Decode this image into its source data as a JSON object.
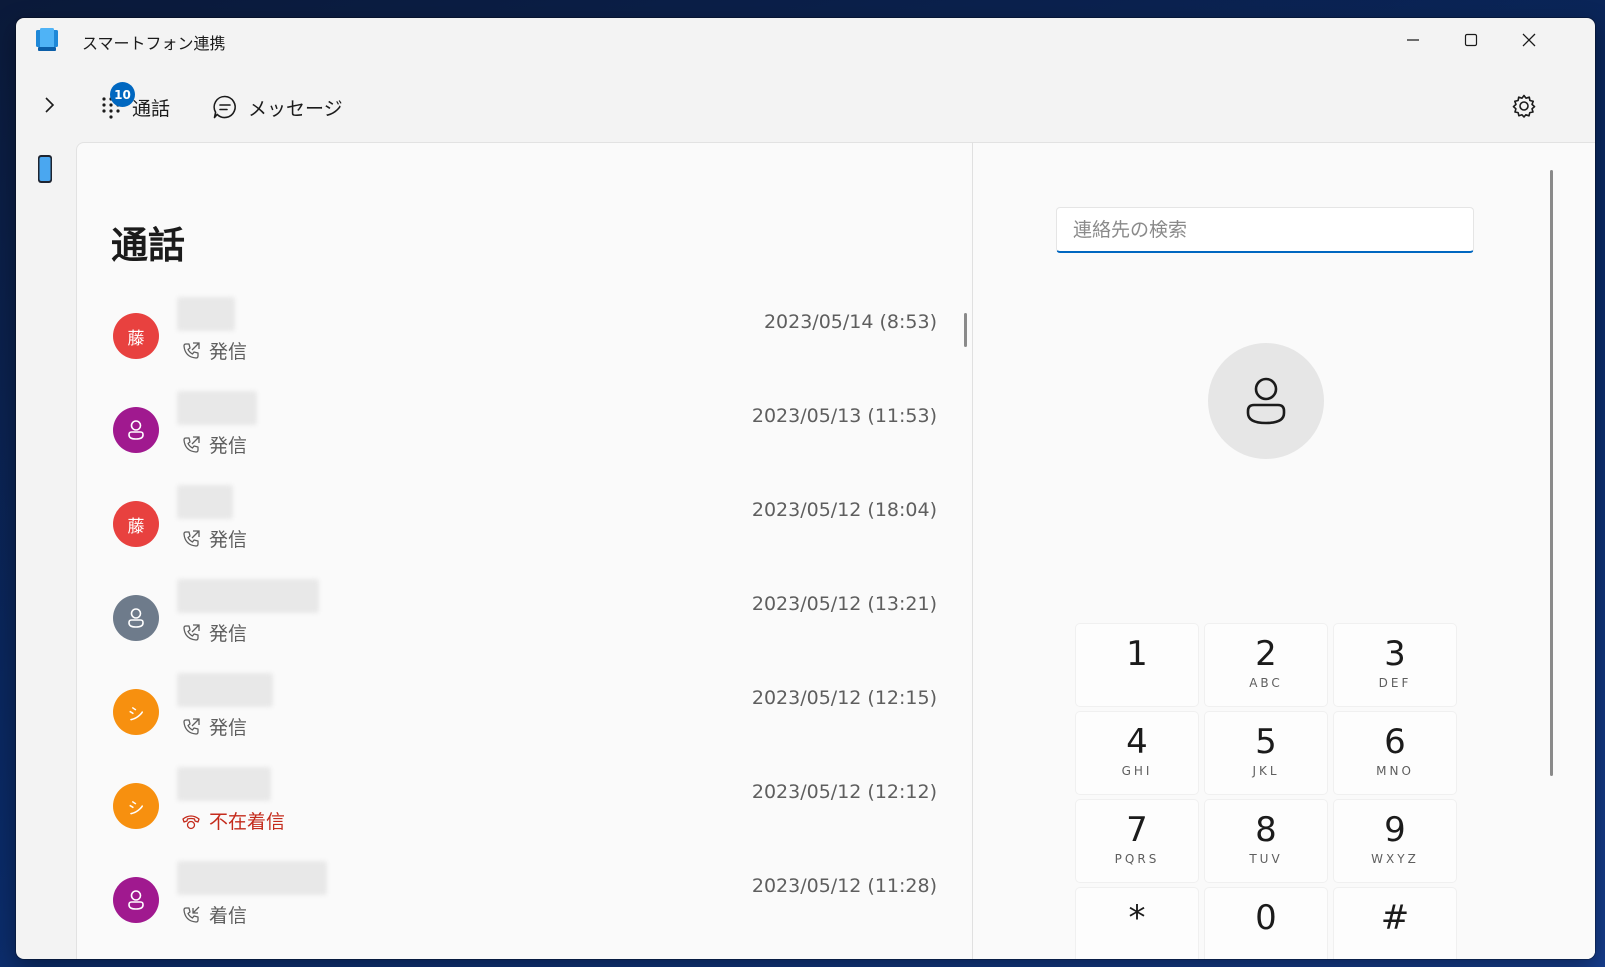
{
  "window": {
    "title": "スマートフォン連携",
    "accent": "#0067c0"
  },
  "nav": {
    "tabs": [
      {
        "label": "通話",
        "badge": "10",
        "selected": true
      },
      {
        "label": "メッセージ",
        "selected": false
      }
    ]
  },
  "calls": {
    "heading": "通話",
    "items": [
      {
        "avatar_text": "藤",
        "avatar_color": "#e8413f",
        "type": "発信",
        "missed": false,
        "date": "2023/05/14 (8:53)"
      },
      {
        "avatar_text": "",
        "avatar_color": "#a0198f",
        "type": "発信",
        "missed": false,
        "date": "2023/05/13 (11:53)"
      },
      {
        "avatar_text": "藤",
        "avatar_color": "#e8413f",
        "type": "発信",
        "missed": false,
        "date": "2023/05/12 (18:04)"
      },
      {
        "avatar_text": "",
        "avatar_color": "#6e7b8b",
        "type": "発信",
        "missed": false,
        "date": "2023/05/12 (13:21)"
      },
      {
        "avatar_text": "シ",
        "avatar_color": "#f7900f",
        "type": "発信",
        "missed": false,
        "date": "2023/05/12 (12:15)"
      },
      {
        "avatar_text": "シ",
        "avatar_color": "#f7900f",
        "type": "不在着信",
        "missed": true,
        "date": "2023/05/12 (12:12)"
      },
      {
        "avatar_text": "",
        "avatar_color": "#a0198f",
        "type": "着信",
        "missed": false,
        "date": "2023/05/12 (11:28)"
      }
    ]
  },
  "dialer": {
    "search_placeholder": "連絡先の検索",
    "keys": [
      {
        "digit": "1",
        "letters": ""
      },
      {
        "digit": "2",
        "letters": "ABC"
      },
      {
        "digit": "3",
        "letters": "DEF"
      },
      {
        "digit": "4",
        "letters": "GHI"
      },
      {
        "digit": "5",
        "letters": "JKL"
      },
      {
        "digit": "6",
        "letters": "MNO"
      },
      {
        "digit": "7",
        "letters": "PQRS"
      },
      {
        "digit": "8",
        "letters": "TUV"
      },
      {
        "digit": "9",
        "letters": "WXYZ"
      },
      {
        "digit": "*",
        "letters": ""
      },
      {
        "digit": "0",
        "letters": ""
      },
      {
        "digit": "#",
        "letters": ""
      }
    ]
  }
}
